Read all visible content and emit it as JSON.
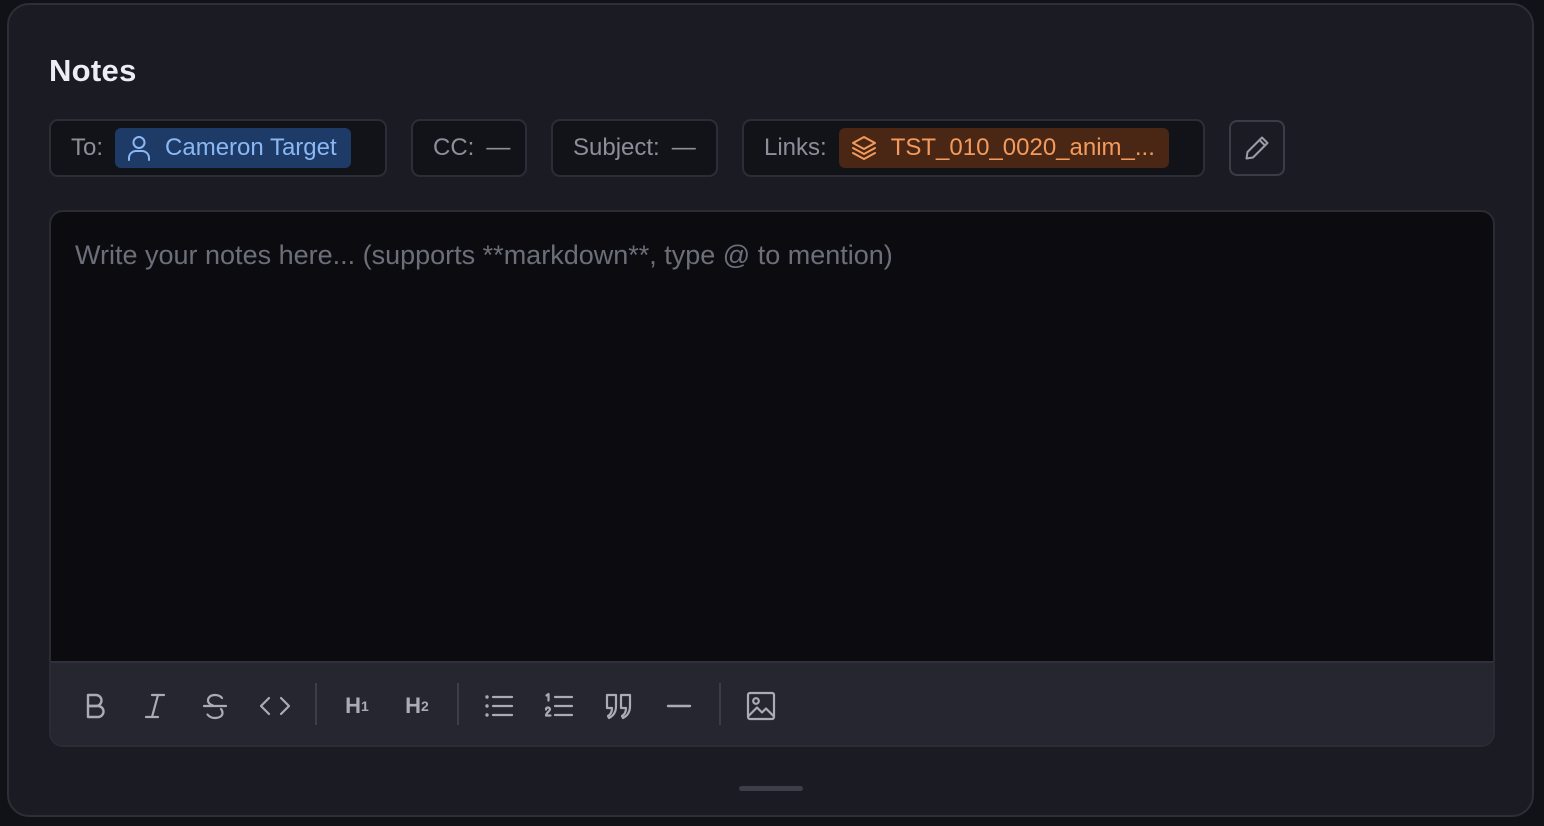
{
  "panel": {
    "title": "Notes"
  },
  "fields": {
    "to": {
      "label": "To:",
      "recipient": "Cameron Target",
      "icon": "user-icon"
    },
    "cc": {
      "label": "CC:",
      "value": "—"
    },
    "subject": {
      "label": "Subject:",
      "value": "—"
    },
    "links": {
      "label": "Links:",
      "item": "TST_010_0020_anim_...",
      "icon": "layers-icon"
    },
    "edit": {
      "icon": "pencil-icon"
    }
  },
  "editor": {
    "placeholder": "Write your notes here... (supports **markdown**, type @ to mention)"
  },
  "toolbar": {
    "h1_label": "H",
    "h1_level": "1",
    "h2_label": "H",
    "h2_level": "2",
    "buttons": [
      "bold-icon",
      "italic-icon",
      "strikethrough-icon",
      "code-icon",
      "heading-1",
      "heading-2",
      "bullet-list-icon",
      "numbered-list-icon",
      "quote-icon",
      "horizontal-rule-icon",
      "image-icon"
    ]
  },
  "colors": {
    "person_chip_bg": "#1e3a66",
    "person_chip_text": "#8ab8f5",
    "link_chip_bg": "#4a2715",
    "link_chip_text": "#f39a5c"
  }
}
